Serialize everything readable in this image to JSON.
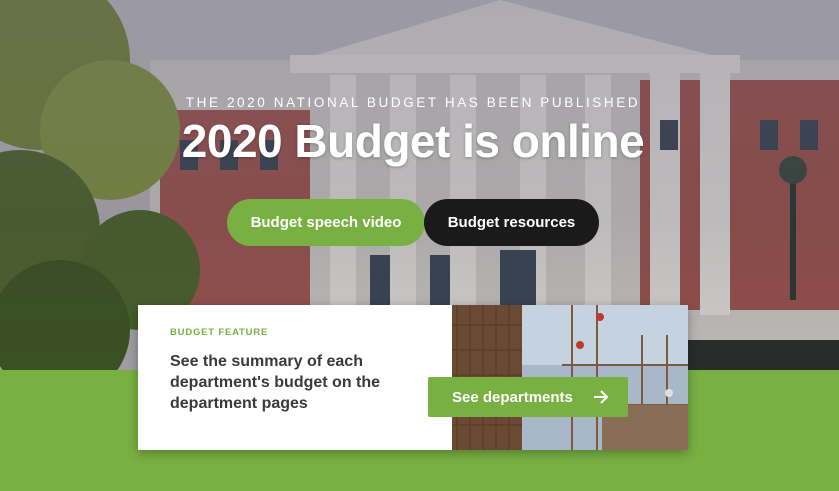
{
  "hero": {
    "eyebrow": "THE 2020 NATIONAL BUDGET HAS BEEN PUBLISHED",
    "title": "2020 Budget is online",
    "primary_button": "Budget speech video",
    "secondary_button": "Budget resources"
  },
  "feature": {
    "label": "BUDGET FEATURE",
    "text": "See the summary of each department's budget on the department pages",
    "button": "See departments",
    "button_icon": "arrow-right-icon"
  },
  "colors": {
    "accent": "#79b042",
    "dark_button": "#1a1a1a"
  }
}
